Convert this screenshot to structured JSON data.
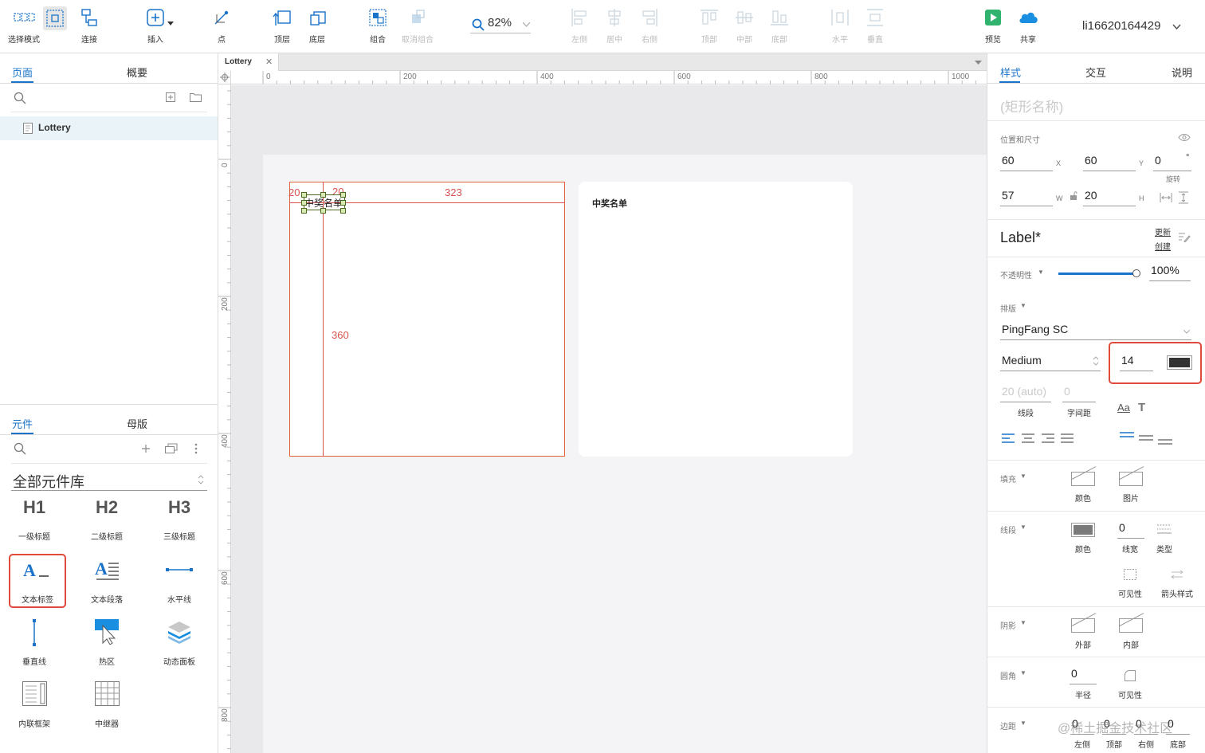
{
  "toolbar": {
    "items": [
      {
        "label": "选择模式",
        "icon": "select-mode-icon"
      },
      {
        "label": "连接",
        "icon": "connect-icon"
      },
      {
        "label": "插入",
        "icon": "insert-icon"
      },
      {
        "label": "点",
        "icon": "point-icon"
      },
      {
        "label": "顶层",
        "icon": "bring-front-icon"
      },
      {
        "label": "底层",
        "icon": "send-back-icon"
      },
      {
        "label": "组合",
        "icon": "group-icon"
      },
      {
        "label": "取消组合",
        "icon": "ungroup-icon"
      },
      {
        "label": "左侧",
        "icon": "align-left-icon"
      },
      {
        "label": "居中",
        "icon": "align-center-icon"
      },
      {
        "label": "右侧",
        "icon": "align-right-icon"
      },
      {
        "label": "顶部",
        "icon": "align-top-icon"
      },
      {
        "label": "中部",
        "icon": "align-middle-icon"
      },
      {
        "label": "底部",
        "icon": "align-bottom-icon"
      },
      {
        "label": "水平",
        "icon": "distribute-h-icon"
      },
      {
        "label": "垂直",
        "icon": "distribute-v-icon"
      },
      {
        "label": "预览",
        "icon": "preview-icon"
      },
      {
        "label": "共享",
        "icon": "share-cloud-icon"
      }
    ],
    "zoom": "82%",
    "user": "li16620164429"
  },
  "pages_panel": {
    "tabs": [
      "页面",
      "概要"
    ],
    "pages": [
      "Lottery"
    ]
  },
  "library_panel": {
    "tabs": [
      "元件",
      "母版"
    ],
    "library_name": "全部元件库",
    "widgets": [
      {
        "glyph": "H1",
        "label": "一级标题"
      },
      {
        "glyph": "H2",
        "label": "二级标题"
      },
      {
        "glyph": "H3",
        "label": "三级标题"
      },
      {
        "glyph": "",
        "label": "文本标签"
      },
      {
        "glyph": "",
        "label": "文本段落"
      },
      {
        "glyph": "",
        "label": "水平线"
      },
      {
        "glyph": "",
        "label": "垂直线"
      },
      {
        "glyph": "",
        "label": "热区"
      },
      {
        "glyph": "",
        "label": "动态面板"
      },
      {
        "glyph": "",
        "label": "内联框架"
      },
      {
        "glyph": "",
        "label": "中继器"
      }
    ]
  },
  "document": {
    "tab_title": "Lottery",
    "ruler_h": [
      "0",
      "200",
      "400",
      "600",
      "800",
      "1000"
    ],
    "ruler_v": [
      "0",
      "200",
      "400",
      "600",
      "800"
    ],
    "measurements": {
      "left": "20",
      "gap": "20",
      "right": "323",
      "bottom": "360"
    },
    "selected_text": "中奖名单",
    "right_card_title": "中奖名单"
  },
  "inspector": {
    "tabs": [
      "样式",
      "交互",
      "说明"
    ],
    "name_placeholder": "(矩形名称)",
    "position_size_title": "位置和尺寸",
    "x": "60",
    "x_label": "X",
    "y": "60",
    "y_label": "Y",
    "rotation": "0",
    "rotation_unit": "°",
    "rotation_label": "旋转",
    "w": "57",
    "w_label": "W",
    "h": "20",
    "h_label": "H",
    "style_name": "Label*",
    "update_label": "更新",
    "create_label": "创建",
    "opacity_label": "不透明性",
    "opacity": "100%",
    "opacity_fraction": 1.0,
    "typography_label": "排版",
    "font_family": "PingFang SC",
    "font_weight": "Medium",
    "font_size": "14",
    "font_color": "#333333",
    "line_height": "20 (auto)",
    "line_height_label": "线段",
    "letter_spacing": "0",
    "letter_spacing_label": "字间距",
    "text_case_glyph": "Aa",
    "text_style_glyph": "T",
    "fill_label": "填充",
    "fill_color_label": "颜色",
    "fill_image_label": "图片",
    "border_label": "线段",
    "border_color_label": "颜色",
    "border_width": "0",
    "border_width_label": "线宽",
    "border_type_label": "类型",
    "visibility_label": "可见性",
    "arrow_label": "箭头样式",
    "shadow_label": "阴影",
    "shadow_outer_label": "外部",
    "shadow_inner_label": "内部",
    "corner_label": "圆角",
    "corner_radius": "0",
    "corner_radius_label": "半径",
    "corner_visibility_label": "可见性",
    "padding_label": "边距",
    "padding": [
      {
        "value": "0",
        "label": "左侧"
      },
      {
        "value": "0",
        "label": "顶部"
      },
      {
        "value": "0",
        "label": "右侧"
      },
      {
        "value": "0",
        "label": "底部"
      }
    ]
  },
  "watermark": "@稀土掘金技术社区",
  "colors": {
    "accent": "#1a73c9",
    "highlight": "#e04a3a",
    "guide": "#d9534f"
  }
}
